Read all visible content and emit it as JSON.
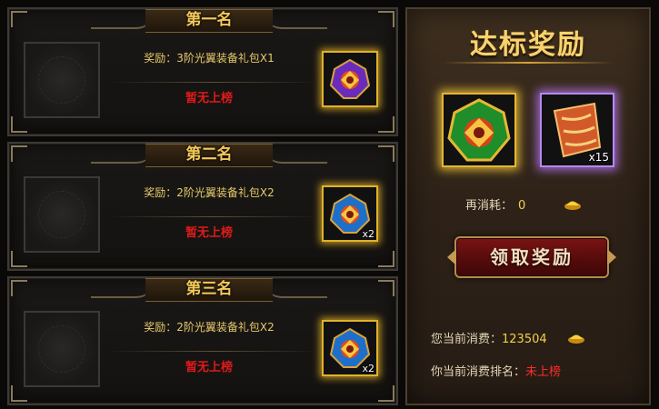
{
  "ranks": [
    {
      "title": "第一名",
      "reward_label": "奖励：",
      "reward": "3阶光翼装备礼包X1",
      "status": "暂无上榜",
      "qty": ""
    },
    {
      "title": "第二名",
      "reward_label": "奖励：",
      "reward": "2阶光翼装备礼包X2",
      "status": "暂无上榜",
      "qty": "x2"
    },
    {
      "title": "第三名",
      "reward_label": "奖励：",
      "reward": "2阶光翼装备礼包X2",
      "status": "暂无上榜",
      "qty": "x2"
    }
  ],
  "side": {
    "title": "达标奖励",
    "item2_qty": "x15",
    "consume_label": "再消耗：",
    "consume_value": "0",
    "claim_button": "领取奖励",
    "current_spend_label": "您当前消费：",
    "current_spend_value": "123504",
    "rank_label": "你当前消费排名：",
    "rank_value": "未上榜"
  },
  "colors": {
    "gold_text": "#f3c95a",
    "status_red": "#e01a1a",
    "value_yellow": "#f0d24a"
  }
}
